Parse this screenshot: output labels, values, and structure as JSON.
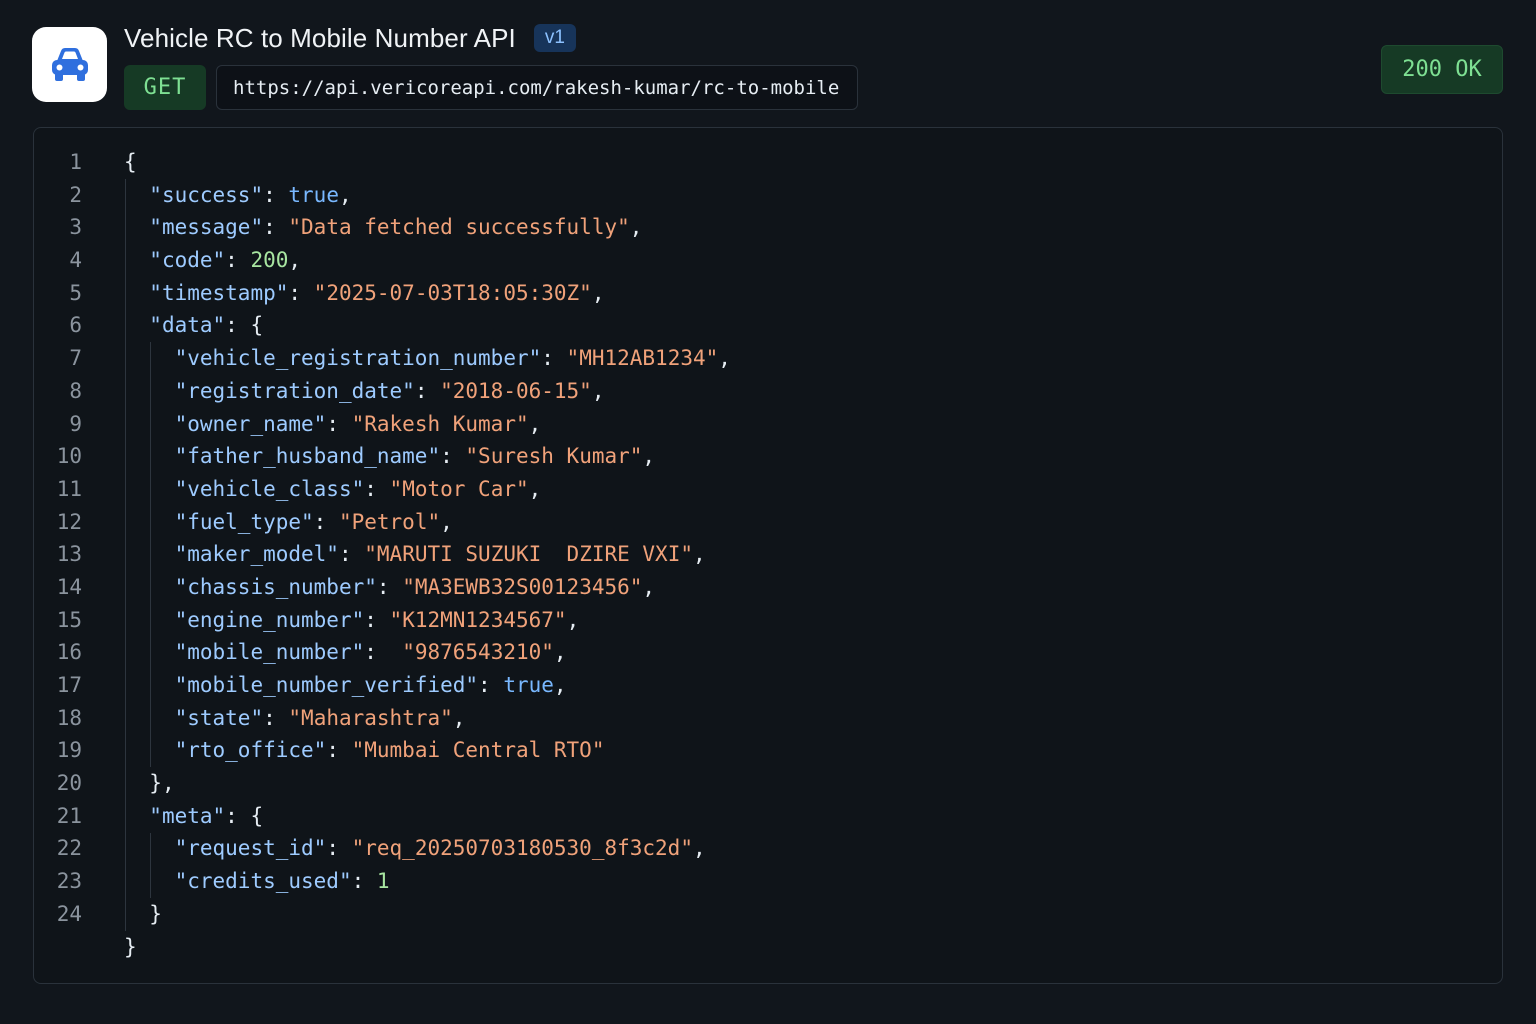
{
  "header": {
    "title": "Vehicle RC to Mobile Number API",
    "version": "v1",
    "method": "GET",
    "url": "https://api.vericoreapi.com/rakesh-kumar/rc-to-mobile",
    "status": "200 OK",
    "icon": "car-icon"
  },
  "colors": {
    "background": "#11161c",
    "method_green": "#7ee093",
    "key_blue": "#9ecbff",
    "string_orange": "#f0a27a"
  },
  "response": {
    "lines": [
      {
        "n": "1",
        "indent": 0,
        "parts": [
          [
            "p",
            "{"
          ]
        ]
      },
      {
        "n": "2",
        "indent": 1,
        "parts": [
          [
            "k",
            "\"success\""
          ],
          [
            "p",
            ": "
          ],
          [
            "b",
            "true"
          ],
          [
            "p",
            ","
          ]
        ]
      },
      {
        "n": "3",
        "indent": 1,
        "parts": [
          [
            "k",
            "\"message\""
          ],
          [
            "p",
            ": "
          ],
          [
            "s",
            "\"Data fetched successfully\""
          ],
          [
            "p",
            ","
          ]
        ]
      },
      {
        "n": "4",
        "indent": 1,
        "parts": [
          [
            "k",
            "\"code\""
          ],
          [
            "p",
            ": "
          ],
          [
            "n",
            "200"
          ],
          [
            "p",
            ","
          ]
        ]
      },
      {
        "n": "5",
        "indent": 1,
        "parts": [
          [
            "k",
            "\"timestamp\""
          ],
          [
            "p",
            ": "
          ],
          [
            "s",
            "\"2025-07-03T18:05:30Z\""
          ],
          [
            "p",
            ","
          ]
        ]
      },
      {
        "n": "6",
        "indent": 1,
        "parts": [
          [
            "k",
            "\"data\""
          ],
          [
            "p",
            ": {"
          ]
        ]
      },
      {
        "n": "7",
        "indent": 2,
        "parts": [
          [
            "k",
            "\"vehicle_registration_number\""
          ],
          [
            "p",
            ": "
          ],
          [
            "s",
            "\"MH12AB1234\""
          ],
          [
            "p",
            ","
          ]
        ]
      },
      {
        "n": "8",
        "indent": 2,
        "parts": [
          [
            "k",
            "\"registration_date\""
          ],
          [
            "p",
            ": "
          ],
          [
            "s",
            "\"2018-06-15\""
          ],
          [
            "p",
            ","
          ]
        ]
      },
      {
        "n": "9",
        "indent": 2,
        "parts": [
          [
            "k",
            "\"owner_name\""
          ],
          [
            "p",
            ": "
          ],
          [
            "s",
            "\"Rakesh Kumar\""
          ],
          [
            "p",
            ","
          ]
        ]
      },
      {
        "n": "10",
        "indent": 2,
        "parts": [
          [
            "k",
            "\"father_husband_name\""
          ],
          [
            "p",
            ": "
          ],
          [
            "s",
            "\"Suresh Kumar\""
          ],
          [
            "p",
            ","
          ]
        ]
      },
      {
        "n": "11",
        "indent": 2,
        "parts": [
          [
            "k",
            "\"vehicle_class\""
          ],
          [
            "p",
            ": "
          ],
          [
            "s",
            "\"Motor Car\""
          ],
          [
            "p",
            ","
          ]
        ]
      },
      {
        "n": "12",
        "indent": 2,
        "parts": [
          [
            "k",
            "\"fuel_type\""
          ],
          [
            "p",
            ": "
          ],
          [
            "s",
            "\"Petrol\""
          ],
          [
            "p",
            ","
          ]
        ]
      },
      {
        "n": "13",
        "indent": 2,
        "parts": [
          [
            "k",
            "\"maker_model\""
          ],
          [
            "p",
            ": "
          ],
          [
            "s",
            "\"MARUTI SUZUKI  DZIRE VXI\""
          ],
          [
            "p",
            ","
          ]
        ]
      },
      {
        "n": "14",
        "indent": 2,
        "parts": [
          [
            "k",
            "\"chassis_number\""
          ],
          [
            "p",
            ": "
          ],
          [
            "s",
            "\"MA3EWB32S00123456\""
          ],
          [
            "p",
            ","
          ]
        ]
      },
      {
        "n": "15",
        "indent": 2,
        "parts": [
          [
            "k",
            "\"engine_number\""
          ],
          [
            "p",
            ": "
          ],
          [
            "s",
            "\"K12MN1234567\""
          ],
          [
            "p",
            ","
          ]
        ]
      },
      {
        "n": "16",
        "indent": 2,
        "parts": [
          [
            "k",
            "\"mobile_number\""
          ],
          [
            "p",
            ":  "
          ],
          [
            "s",
            "\"9876543210\""
          ],
          [
            "p",
            ","
          ]
        ]
      },
      {
        "n": "17",
        "indent": 2,
        "parts": [
          [
            "k",
            "\"mobile_number_verified\""
          ],
          [
            "p",
            ": "
          ],
          [
            "b",
            "true"
          ],
          [
            "p",
            ","
          ]
        ]
      },
      {
        "n": "18",
        "indent": 2,
        "parts": [
          [
            "k",
            "\"state\""
          ],
          [
            "p",
            ": "
          ],
          [
            "s",
            "\"Maharashtra\""
          ],
          [
            "p",
            ","
          ]
        ]
      },
      {
        "n": "19",
        "indent": 2,
        "parts": [
          [
            "k",
            "\"rto_office\""
          ],
          [
            "p",
            ": "
          ],
          [
            "s",
            "\"Mumbai Central RTO\""
          ]
        ]
      },
      {
        "n": "20",
        "indent": 1,
        "parts": [
          [
            "p",
            "},"
          ]
        ]
      },
      {
        "n": "21",
        "indent": 1,
        "parts": [
          [
            "k",
            "\"meta\""
          ],
          [
            "p",
            ": {"
          ]
        ]
      },
      {
        "n": "22",
        "indent": 2,
        "parts": [
          [
            "k",
            "\"request_id\""
          ],
          [
            "p",
            ": "
          ],
          [
            "s",
            "\"req_20250703180530_8f3c2d\""
          ],
          [
            "p",
            ","
          ]
        ]
      },
      {
        "n": "23",
        "indent": 2,
        "parts": [
          [
            "k",
            "\"credits_used\""
          ],
          [
            "p",
            ": "
          ],
          [
            "n",
            "1"
          ]
        ]
      },
      {
        "n": "24",
        "indent": 1,
        "parts": [
          [
            "p",
            "}"
          ]
        ]
      },
      {
        "n": "",
        "indent": 0,
        "parts": [
          [
            "p",
            "}"
          ]
        ]
      }
    ]
  }
}
